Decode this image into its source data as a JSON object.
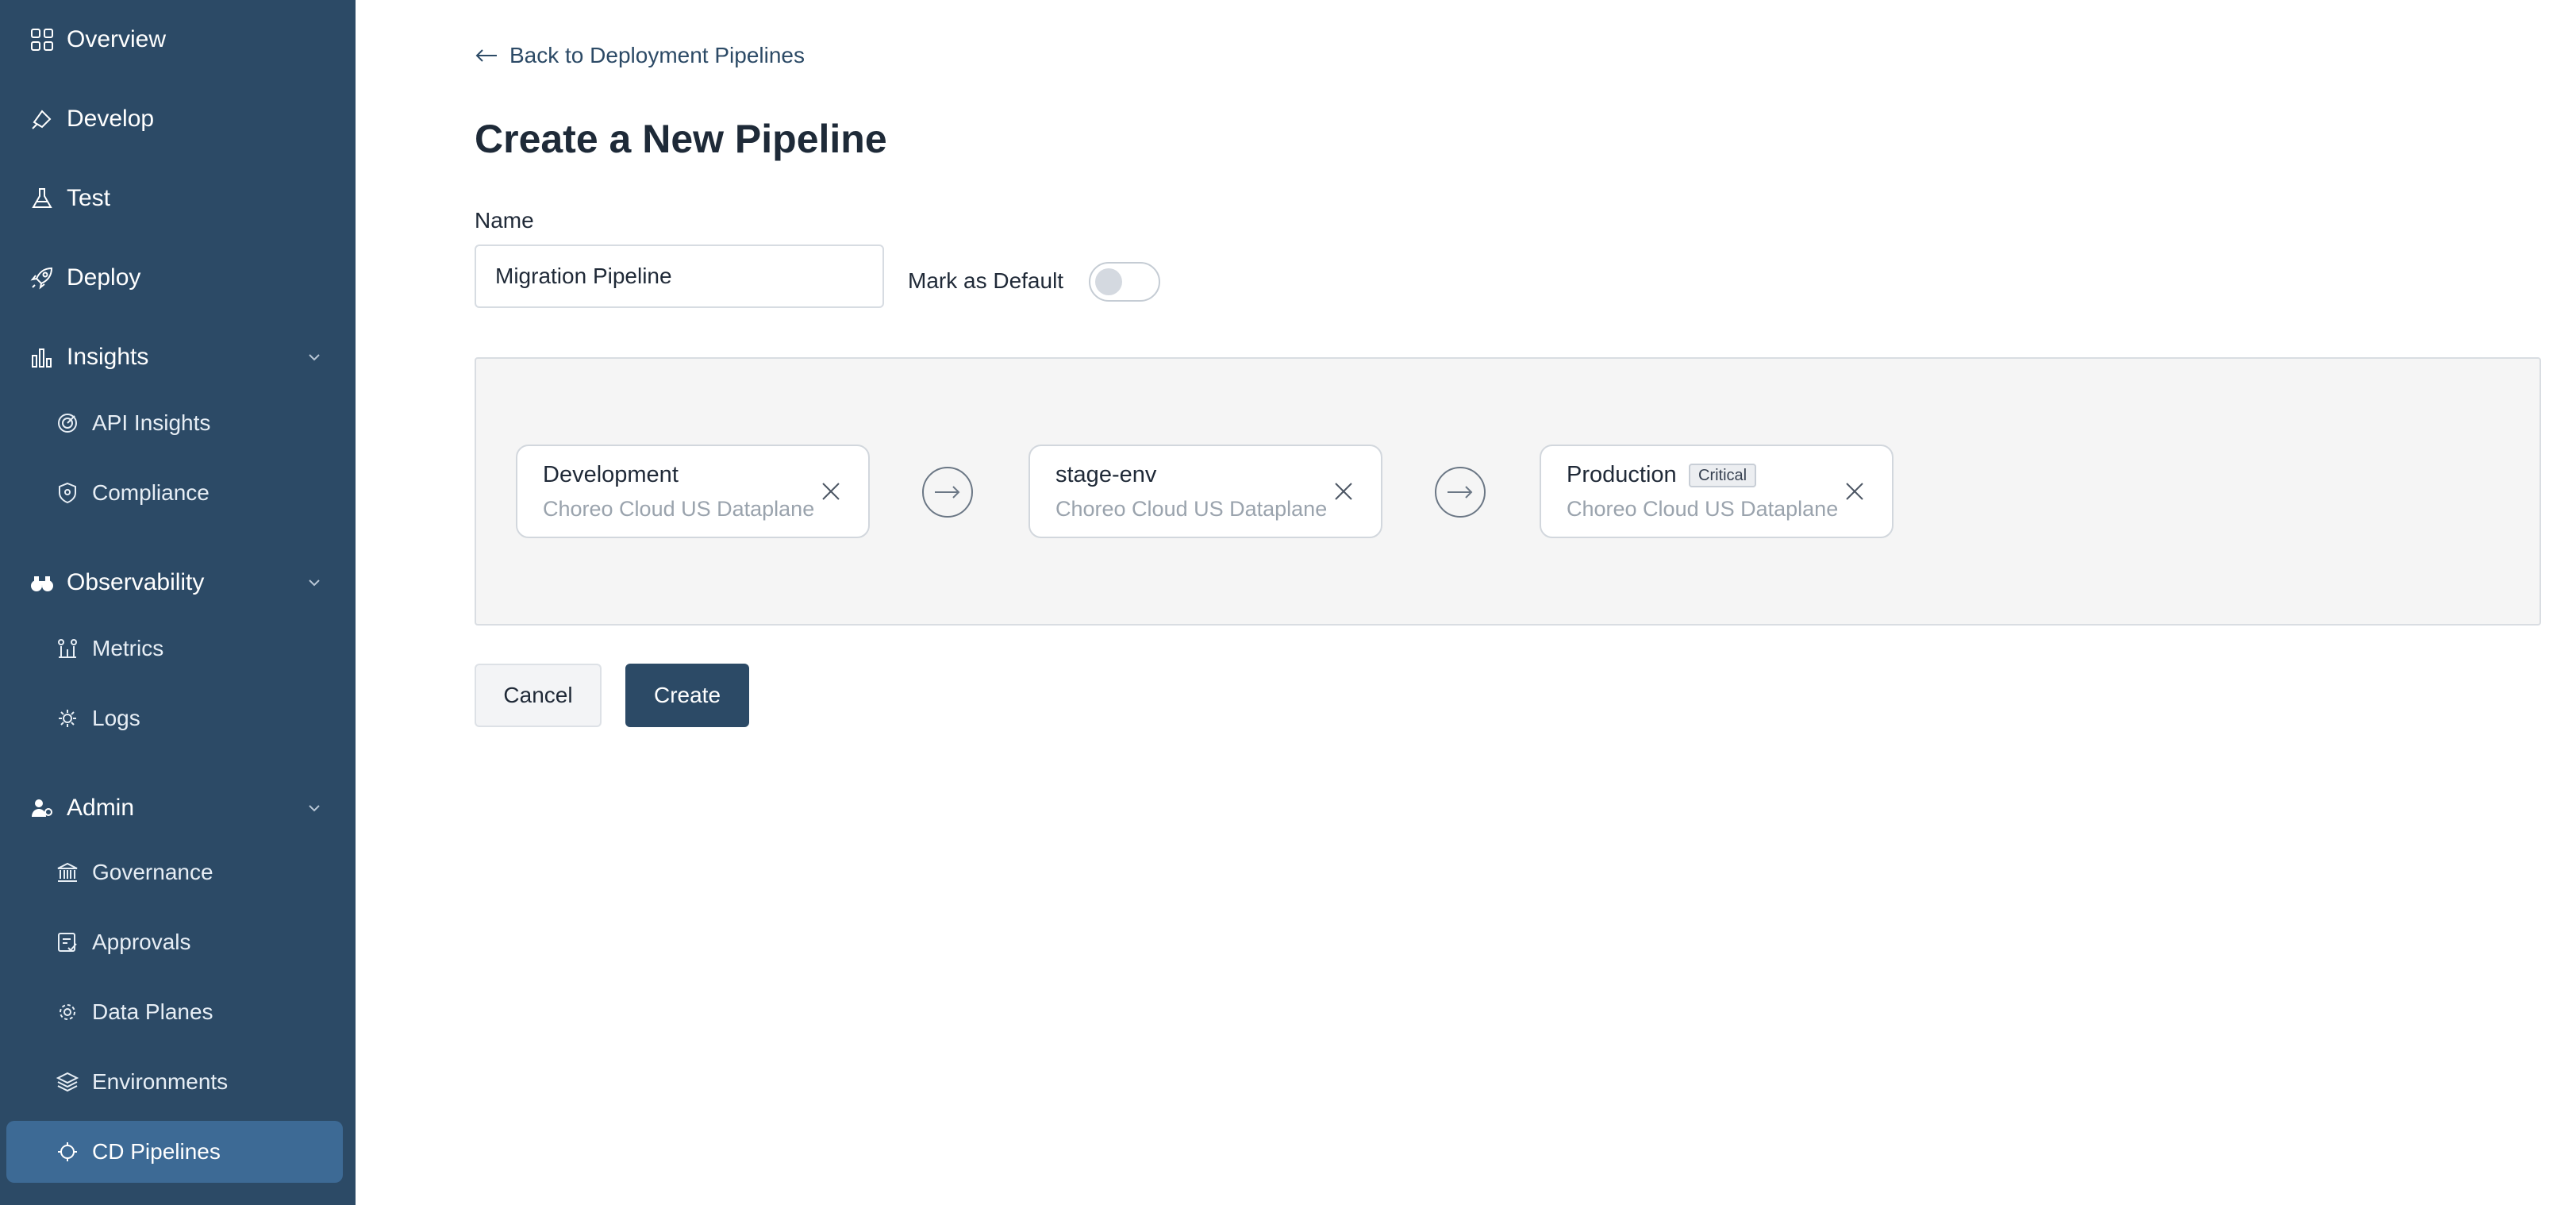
{
  "sidebar": {
    "items": [
      {
        "label": "Overview",
        "icon": "grid-icon"
      },
      {
        "label": "Develop",
        "icon": "develop-icon"
      },
      {
        "label": "Test",
        "icon": "flask-icon"
      },
      {
        "label": "Deploy",
        "icon": "rocket-icon"
      },
      {
        "label": "Insights",
        "icon": "bar-chart-icon",
        "expanded": true
      },
      {
        "label": "API Insights",
        "icon": "api-insights-icon"
      },
      {
        "label": "Compliance",
        "icon": "shield-icon"
      },
      {
        "label": "Observability",
        "icon": "binoculars-icon",
        "expanded": true
      },
      {
        "label": "Metrics",
        "icon": "metrics-icon"
      },
      {
        "label": "Logs",
        "icon": "logs-icon"
      },
      {
        "label": "Admin",
        "icon": "user-admin-icon",
        "expanded": true
      },
      {
        "label": "Governance",
        "icon": "bank-icon"
      },
      {
        "label": "Approvals",
        "icon": "approvals-icon"
      },
      {
        "label": "Data Planes",
        "icon": "gear-icon"
      },
      {
        "label": "Environments",
        "icon": "layers-icon"
      },
      {
        "label": "CD Pipelines",
        "icon": "pipeline-icon",
        "active": true
      }
    ]
  },
  "main": {
    "back_link": "Back to Deployment Pipelines",
    "title": "Create a New Pipeline",
    "name_label": "Name",
    "name_value": "Migration Pipeline",
    "default_label": "Mark as Default",
    "default_on": false,
    "environments": [
      {
        "name": "Development",
        "dataplane": "Choreo Cloud US Dataplane",
        "badge": ""
      },
      {
        "name": "stage-env",
        "dataplane": "Choreo Cloud US Dataplane",
        "badge": ""
      },
      {
        "name": "Production",
        "dataplane": "Choreo Cloud US Dataplane",
        "badge": "Critical"
      }
    ],
    "cancel_label": "Cancel",
    "create_label": "Create"
  },
  "colors": {
    "sidebar_bg": "#2c4a66",
    "sidebar_active": "#3d6a95",
    "primary": "#2c4a66"
  }
}
